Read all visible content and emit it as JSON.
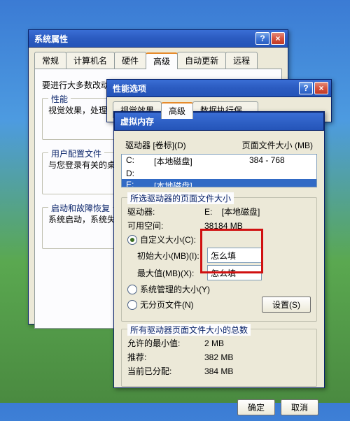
{
  "sysprops": {
    "title": "系统属性",
    "tabs": [
      "常规",
      "计算机名",
      "硬件",
      "高级",
      "自动更新",
      "远程"
    ],
    "active_tab_index": 3,
    "hint": "要进行大多数改动，您必须作为管理员登录。",
    "group_performance": {
      "title": "性能",
      "line": "视觉效果，处理器…"
    },
    "group_userprofiles": {
      "title": "用户配置文件",
      "line": "与您登录有关的桌…"
    },
    "group_startup": {
      "title": "启动和故障恢复",
      "line": "系统启动，系统失…"
    }
  },
  "perfopts": {
    "title": "性能选项",
    "tabs": [
      "视觉效果",
      "高级",
      "数据执行保…"
    ],
    "active_tab_index": 1
  },
  "vm": {
    "title": "虚拟内存",
    "drive_header_col1": "驱动器 [卷标](D)",
    "drive_header_col2": "页面文件大小 (MB)",
    "drives": [
      {
        "letter": "C:",
        "label": "[本地磁盘]",
        "paging": "384 - 768"
      },
      {
        "letter": "D:",
        "label": "",
        "paging": ""
      },
      {
        "letter": "E:",
        "label": "[本地磁盘]",
        "paging": ""
      }
    ],
    "selected_index": 2,
    "group_selected_title": "所选驱动器的页面文件大小",
    "kv_drive_label": "驱动器:",
    "kv_drive_value": "E:    [本地磁盘]",
    "kv_free_label": "可用空间:",
    "kv_free_value": "38184 MB",
    "radio_custom": "自定义大小(C):",
    "initial_label": "初始大小(MB)(I):",
    "initial_value": "怎么填",
    "max_label": "最大值(MB)(X):",
    "max_value": "怎么填",
    "radio_system": "系统管理的大小(Y)",
    "radio_none": "无分页文件(N)",
    "set_button": "设置(S)",
    "group_total_title": "所有驱动器页面文件大小的总数",
    "min_allowed_label": "允许的最小值:",
    "min_allowed_value": "2 MB",
    "recommended_label": "推荐:",
    "recommended_value": "382 MB",
    "current_label": "当前已分配:",
    "current_value": "384 MB",
    "ok": "确定",
    "cancel": "取消"
  }
}
